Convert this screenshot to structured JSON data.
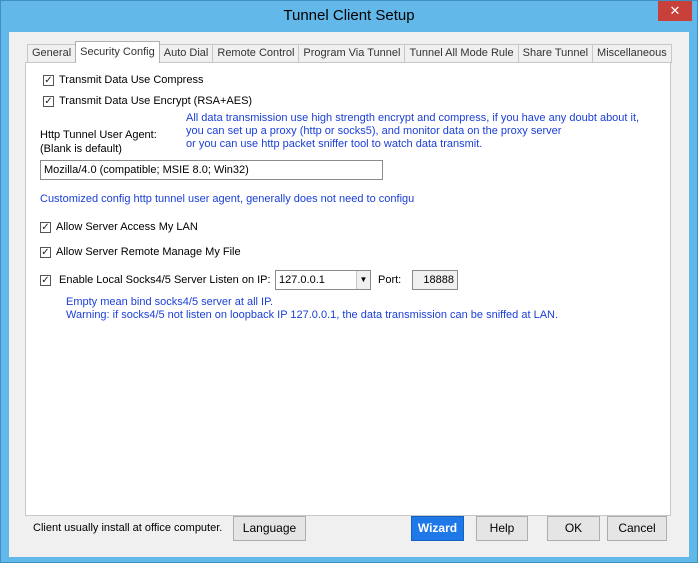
{
  "window": {
    "title": "Tunnel Client Setup",
    "close_glyph": "✕"
  },
  "tabs": [
    {
      "label": "General"
    },
    {
      "label": "Security Config"
    },
    {
      "label": "Auto Dial"
    },
    {
      "label": "Remote Control"
    },
    {
      "label": "Program Via Tunnel"
    },
    {
      "label": "Tunnel All Mode Rule"
    },
    {
      "label": "Share Tunnel"
    },
    {
      "label": "Miscellaneous"
    }
  ],
  "active_tab": "Security Config",
  "security": {
    "compress_label": "Transmit Data Use Compress",
    "compress_checked": true,
    "encrypt_label": "Transmit Data Use Encrypt (RSA+AES)",
    "encrypt_checked": true,
    "info_line1": "All data transmission use high strength encrypt and compress, if you have any doubt about it,",
    "info_line2": "you can set up a proxy (http or socks5), and monitor data on the proxy server",
    "info_line3": "or you can use http packet sniffer tool to watch data transmit.",
    "agent_label_line1": "Http Tunnel User Agent:",
    "agent_label_line2": "(Blank is default)",
    "agent_value": "Mozilla/4.0 (compatible; MSIE 8.0; Win32)",
    "agent_hint": "Customized config http tunnel user agent, generally does not need to configu",
    "allow_lan_label": "Allow Server Access My  LAN",
    "allow_lan_checked": true,
    "allow_manage_label": "Allow Server Remote Manage My File",
    "allow_manage_checked": true,
    "socks_label": "Enable Local Socks4/5 Server Listen on IP:",
    "socks_checked": true,
    "socks_ip": "127.0.0.1",
    "port_label": "Port:",
    "port_value": "18888",
    "socks_note1": "Empty mean bind socks4/5 server at all IP.",
    "socks_note2": "Warning: if socks4/5 not listen on loopback IP 127.0.0.1, the data transmission can be sniffed at LAN."
  },
  "footer": {
    "note": "Client usually install at office computer.",
    "language_label": "Language",
    "wizard_label": "Wizard",
    "help_label": "Help",
    "ok_label": "OK",
    "cancel_label": "Cancel"
  },
  "colors": {
    "accent": "#1e78e8",
    "titlebar": "#62b8e8",
    "info_text": "#1a3fd6",
    "close": "#c7413a"
  }
}
